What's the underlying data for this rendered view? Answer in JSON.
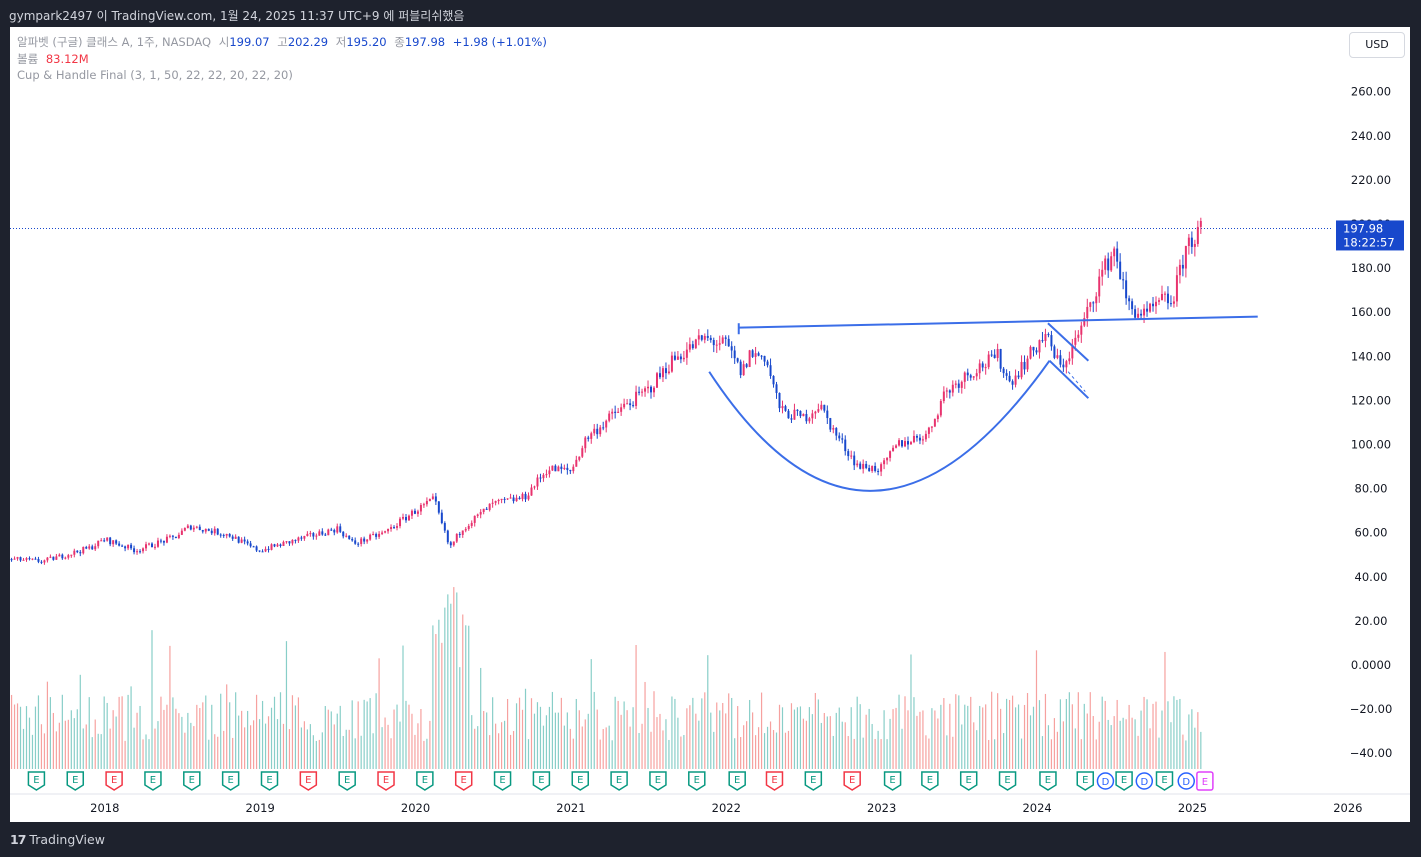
{
  "header": {
    "publish_text": "gympark2497 이 TradingView.com, 1월 24, 2025 11:37 UTC+9 에 퍼블리쉬했음"
  },
  "legend": {
    "symbol": "알파벳 (구글) 클래스 A, 1주, NASDAQ",
    "open_label": "시",
    "open": "199.07",
    "high_label": "고",
    "high": "202.29",
    "low_label": "저",
    "low": "195.20",
    "close_label": "종",
    "close": "197.98",
    "change": "+1.98 (+1.01%)",
    "volume_label": "볼륨",
    "volume": "83.12M",
    "indicator": "Cup & Handle Final (3, 1, 50, 22, 22, 20, 22, 20)"
  },
  "currency_button": "USD",
  "footer": {
    "brand": "TradingView",
    "logo_mark": "17"
  },
  "colors": {
    "up": "#e8336e",
    "down": "#1848cc",
    "pattern": "#3b6ee8",
    "volume_up": "#26a69a",
    "volume_down": "#ef5350",
    "earnings": "#089981",
    "earnings_missed": "#f23645",
    "dividend": "#2962ff",
    "upcoming": "#e040fb"
  },
  "chart_data": {
    "type": "candlestick",
    "symbol": "알파벳 (구글) 클래스 A",
    "interval": "1주",
    "exchange": "NASDAQ",
    "x_ticks": [
      "2018",
      "2019",
      "2020",
      "2021",
      "2022",
      "2023",
      "2024",
      "2025",
      "2026"
    ],
    "price_ticks": [
      "260.00",
      "240.00",
      "220.00",
      "200.00",
      "180.00",
      "160.00",
      "140.00",
      "120.00",
      "100.00",
      "80.00",
      "60.00",
      "40.00",
      "20.00",
      "0.0000",
      "−20.00",
      "−40.00"
    ],
    "price_range": [
      -46,
      268
    ],
    "last_price": 197.98,
    "last_price_label": "197.98",
    "countdown": "18:22:57",
    "price_path": [
      [
        2017.4,
        48
      ],
      [
        2017.6,
        47
      ],
      [
        2017.9,
        53
      ],
      [
        2018.0,
        57
      ],
      [
        2018.2,
        52
      ],
      [
        2018.45,
        58
      ],
      [
        2018.55,
        63
      ],
      [
        2018.8,
        59
      ],
      [
        2018.95,
        53
      ],
      [
        2019.0,
        52
      ],
      [
        2019.3,
        58
      ],
      [
        2019.5,
        62
      ],
      [
        2019.6,
        55
      ],
      [
        2019.8,
        60
      ],
      [
        2020.0,
        70
      ],
      [
        2020.12,
        75
      ],
      [
        2020.15,
        68
      ],
      [
        2020.22,
        53
      ],
      [
        2020.3,
        62
      ],
      [
        2020.5,
        73
      ],
      [
        2020.7,
        76
      ],
      [
        2020.85,
        89
      ],
      [
        2021.0,
        88
      ],
      [
        2021.1,
        103
      ],
      [
        2021.3,
        115
      ],
      [
        2021.5,
        125
      ],
      [
        2021.65,
        138
      ],
      [
        2021.85,
        148
      ],
      [
        2021.95,
        146
      ],
      [
        2022.0,
        145
      ],
      [
        2022.1,
        132
      ],
      [
        2022.15,
        141
      ],
      [
        2022.25,
        140
      ],
      [
        2022.35,
        115
      ],
      [
        2022.5,
        112
      ],
      [
        2022.6,
        118
      ],
      [
        2022.7,
        105
      ],
      [
        2022.85,
        90
      ],
      [
        2023.0,
        89
      ],
      [
        2023.1,
        100
      ],
      [
        2023.3,
        105
      ],
      [
        2023.4,
        123
      ],
      [
        2023.55,
        132
      ],
      [
        2023.75,
        140
      ],
      [
        2023.82,
        128
      ],
      [
        2023.95,
        140
      ],
      [
        2024.05,
        150
      ],
      [
        2024.15,
        135
      ],
      [
        2024.2,
        140
      ],
      [
        2024.3,
        155
      ],
      [
        2024.4,
        175
      ],
      [
        2024.5,
        189
      ],
      [
        2024.58,
        163
      ],
      [
        2024.7,
        158
      ],
      [
        2024.8,
        165
      ],
      [
        2024.87,
        165
      ],
      [
        2024.92,
        178
      ],
      [
        2024.96,
        190
      ],
      [
        2025.06,
        198
      ]
    ],
    "volume_range": [
      0,
      120
    ],
    "volume_note": "weekly volume histogram, separate pane",
    "events": {
      "earnings": [
        2017.56,
        2017.81,
        2018.06,
        2018.31,
        2018.56,
        2018.81,
        2019.06,
        2019.31,
        2019.56,
        2019.81,
        2020.06,
        2020.31,
        2020.56,
        2020.81,
        2021.06,
        2021.31,
        2021.56,
        2021.81,
        2022.07,
        2022.31,
        2022.56,
        2022.81,
        2023.07,
        2023.31,
        2023.56,
        2023.81,
        2024.07,
        2024.31,
        2024.56,
        2024.82
      ],
      "missed": [
        2018.06,
        2019.31,
        2019.81,
        2020.31,
        2022.31,
        2022.81
      ],
      "dividend": [
        2024.44,
        2024.69,
        2024.96
      ],
      "upcoming": [
        2025.08
      ],
      "earnings_letter": "E",
      "dividend_letter": "D"
    },
    "pattern": {
      "name": "Cup & Handle Final",
      "rim": [
        [
          2022.08,
          153
        ],
        [
          2025.42,
          158
        ]
      ],
      "rim_left_tick": [
        [
          2022.08,
          150
        ],
        [
          2022.08,
          155
        ]
      ],
      "cup": [
        [
          2021.89,
          133
        ],
        [
          2022.95,
          79
        ],
        [
          2024.08,
          138
        ]
      ],
      "handle_upper": [
        [
          2024.07,
          155
        ],
        [
          2024.33,
          138
        ]
      ],
      "handle_lower": [
        [
          2024.08,
          138
        ],
        [
          2024.33,
          121
        ]
      ],
      "handle_dash": [
        [
          2024.2,
          133
        ],
        [
          2024.31,
          124
        ]
      ]
    }
  }
}
